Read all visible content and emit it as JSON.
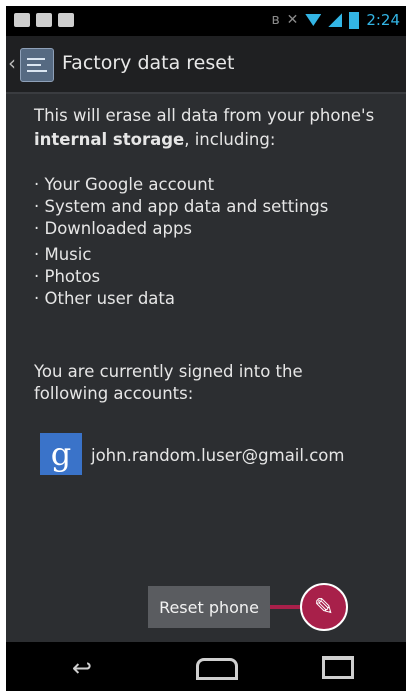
{
  "statusbar": {
    "time": "2:24",
    "icons": [
      "chat-icon",
      "bag-icon",
      "gamepad-icon",
      "bluetooth-icon",
      "mute-icon",
      "wifi-icon",
      "signal-icon",
      "battery-icon"
    ]
  },
  "actionbar": {
    "title": "Factory data reset",
    "icon": "settings-icon"
  },
  "content": {
    "intro_line1": "This will erase all data from your phone's",
    "intro_bold": "internal storage",
    "intro_rest": ", including:",
    "items": [
      "· Your Google account",
      "· System and app data and settings",
      "· Downloaded apps",
      "· Music",
      "· Photos",
      "· Other user data"
    ],
    "accounts_line1": "You are currently signed into the",
    "accounts_line2": "following accounts:",
    "account": {
      "icon_letter": "g",
      "email": "john.random.luser@gmail.com"
    }
  },
  "button": {
    "reset_label": "Reset phone"
  },
  "callout": {
    "symbol": "✎"
  },
  "colors": {
    "background": "#2c2e31",
    "accent": "#33b5e5",
    "callout": "#a8204a",
    "google_blue": "#3a73c9"
  },
  "navbar": {
    "icons": [
      "back-icon",
      "home-icon",
      "recent-apps-icon"
    ]
  }
}
